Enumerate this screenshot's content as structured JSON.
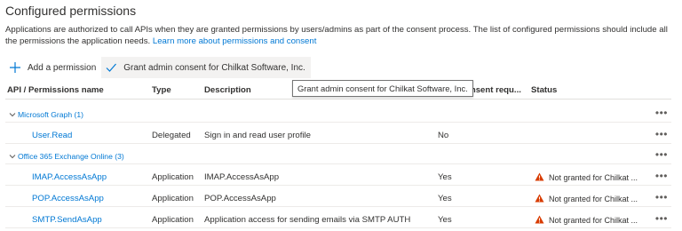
{
  "header": {
    "title": "Configured permissions",
    "description": "Applications are authorized to call APIs when they are granted permissions by users/admins as part of the consent process. The list of configured permissions should include all the permissions the application needs.",
    "link_text": "Learn more about permissions and consent"
  },
  "toolbar": {
    "add_label": "Add a permission",
    "grant_label": "Grant admin consent for Chilkat Software, Inc."
  },
  "tooltip": "Grant admin consent for Chilkat Software, Inc.",
  "columns": {
    "name": "API / Permissions name",
    "type": "Type",
    "description": "Description",
    "consent": "Admin consent requ...",
    "consent_visible": "onsent requ...",
    "status": "Status"
  },
  "groups": [
    {
      "label": "Microsoft Graph (1)",
      "rows": [
        {
          "name": "User.Read",
          "type": "Delegated",
          "description": "Sign in and read user profile",
          "consent": "No",
          "status": ""
        }
      ]
    },
    {
      "label": "Office 365 Exchange Online (3)",
      "rows": [
        {
          "name": "IMAP.AccessAsApp",
          "type": "Application",
          "description": "IMAP.AccessAsApp",
          "consent": "Yes",
          "status": "Not granted for Chilkat ..."
        },
        {
          "name": "POP.AccessAsApp",
          "type": "Application",
          "description": "POP.AccessAsApp",
          "consent": "Yes",
          "status": "Not granted for Chilkat ..."
        },
        {
          "name": "SMTP.SendAsApp",
          "type": "Application",
          "description": "Application access for sending emails via SMTP AUTH",
          "consent": "Yes",
          "status": "Not granted for Chilkat ..."
        }
      ]
    }
  ],
  "more_label": "•••",
  "icons": {
    "add": "plus-icon",
    "grant": "checkmark-icon",
    "group_toggle": "chevron-down-icon",
    "warning": "warning-icon",
    "more": "more-icon"
  },
  "colors": {
    "link": "#0078d4",
    "warning": "#d83b01",
    "text": "#323130"
  }
}
